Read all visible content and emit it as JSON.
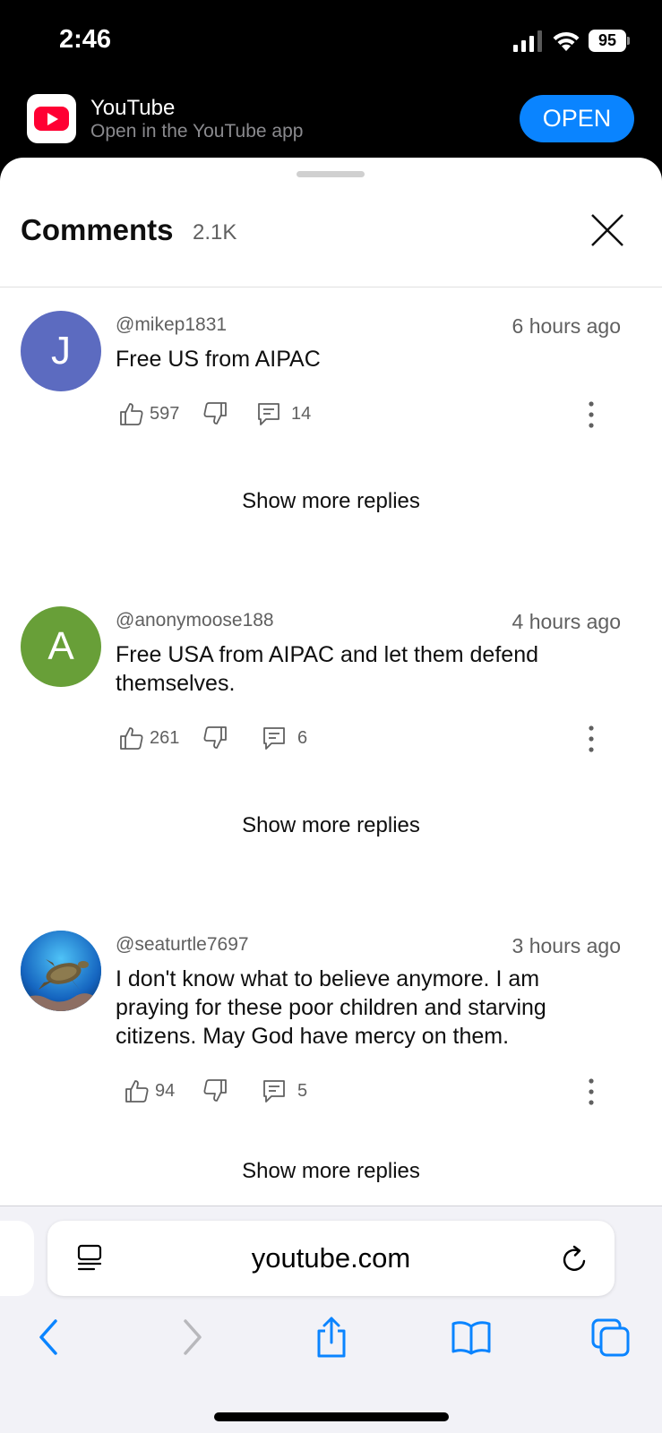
{
  "status_bar": {
    "time": "2:46",
    "battery": "95"
  },
  "app_banner": {
    "app_name": "YouTube",
    "subtitle": "Open in the YouTube app",
    "open_label": "OPEN"
  },
  "comments_sheet": {
    "title": "Comments",
    "count": "2.1K",
    "comments": [
      {
        "avatar_letter": "J",
        "avatar_color": "#5c6bc0",
        "handle": "@mikep1831",
        "time": "6 hours ago",
        "text": "Free US from AIPAC",
        "likes": "597",
        "replies": "14"
      },
      {
        "avatar_letter": "A",
        "avatar_color": "#689f38",
        "handle": "@anonymoose188",
        "time": "4 hours ago",
        "text": "Free USA from AIPAC and let them defend themselves.",
        "likes": "261",
        "replies": "6"
      },
      {
        "avatar_letter": "",
        "avatar_image": "sea-turtle",
        "handle": "@seaturtle7697",
        "time": "3 hours ago",
        "text": "I don't know what to believe anymore. I am praying for these poor children and starving citizens. May God have mercy on them.",
        "likes": "94",
        "replies": "5"
      }
    ],
    "show_more_label": "Show more replies"
  },
  "safari": {
    "url": "youtube.com"
  },
  "colors": {
    "accent": "#0a84ff",
    "youtube_red": "#ff0033"
  }
}
